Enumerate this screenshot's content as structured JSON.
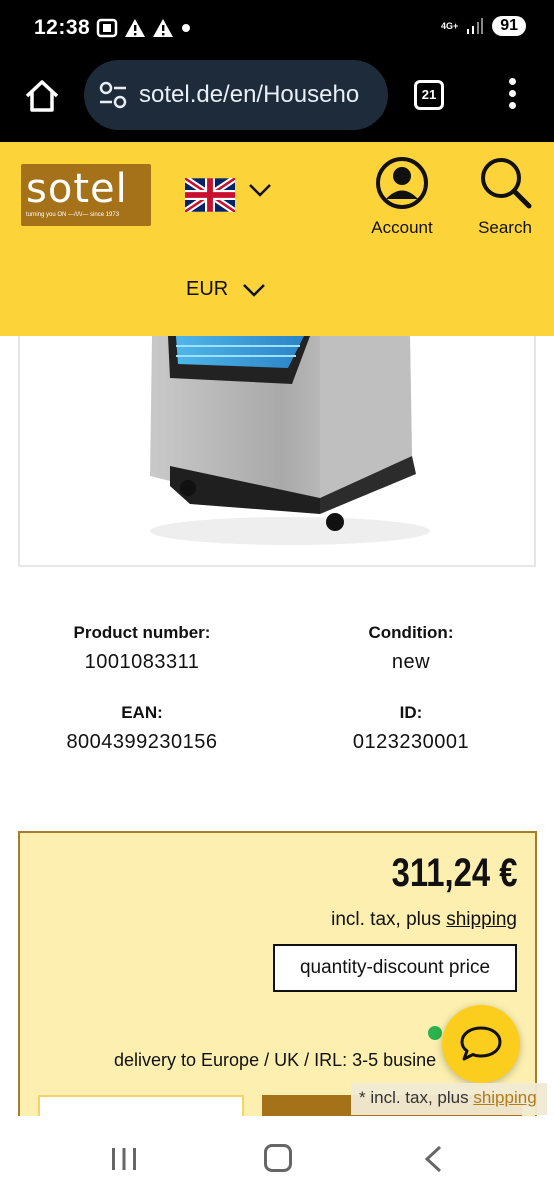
{
  "status_bar": {
    "time": "12:38",
    "network": "4G+",
    "battery": "91"
  },
  "browser": {
    "url": "sotel.de/en/Househo",
    "tab_count": "21"
  },
  "header": {
    "logo_text": "sotel",
    "logo_tagline": "turning you ON —/\\/\\/— since 1973",
    "account_label": "Account",
    "search_label": "Search",
    "currency": "EUR"
  },
  "specs": {
    "product_number_label": "Product number:",
    "product_number": "1001083311",
    "condition_label": "Condition:",
    "condition": "new",
    "ean_label": "EAN:",
    "ean": "8004399230156",
    "id_label": "ID:",
    "id": "0123230001"
  },
  "pricing": {
    "price": "311,24 €",
    "tax_prefix": "incl. tax, plus ",
    "shipping_link": "shipping",
    "quantity_discount_button": "quantity-discount price",
    "delivery": "delivery to Europe / UK / IRL: 3-5 busine"
  },
  "floating_note": {
    "prefix": "* incl. tax, plus ",
    "link": "shipping"
  },
  "colors": {
    "header_yellow": "#fdd33a",
    "brand_brown": "#a5721a",
    "price_box_bg": "#fcefb0",
    "in_stock_green": "#2bb24c"
  }
}
